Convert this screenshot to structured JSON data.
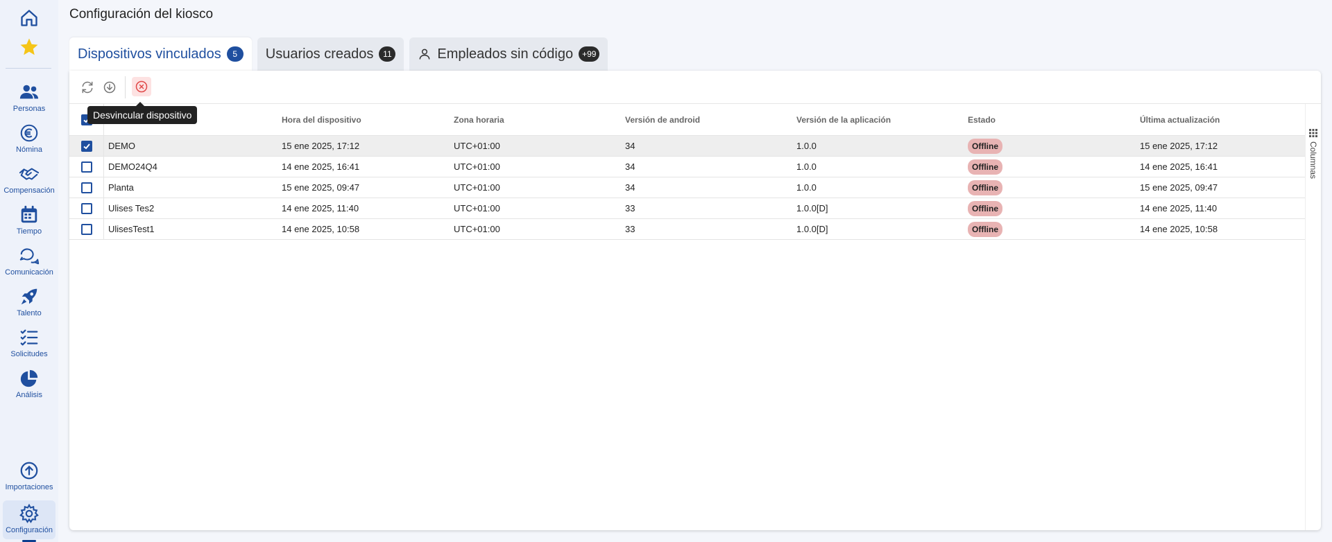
{
  "page": {
    "title": "Configuración del kiosco"
  },
  "sidebar": {
    "items": [
      {
        "label": "Personas",
        "icon": "people-icon"
      },
      {
        "label": "Nómina",
        "icon": "euro-icon"
      },
      {
        "label": "Compensación",
        "icon": "handshake-icon"
      },
      {
        "label": "Tiempo",
        "icon": "calendar-icon"
      },
      {
        "label": "Comunicación",
        "icon": "chat-icon"
      },
      {
        "label": "Talento",
        "icon": "rocket-icon"
      },
      {
        "label": "Solicitudes",
        "icon": "checklist-icon"
      },
      {
        "label": "Análisis",
        "icon": "pie-chart-icon"
      }
    ],
    "bottom": [
      {
        "label": "Importaciones",
        "icon": "upload-icon"
      },
      {
        "label": "Configuración",
        "icon": "gear-icon"
      }
    ]
  },
  "tabs": [
    {
      "label": "Dispositivos vinculados",
      "badge": "5"
    },
    {
      "label": "Usuarios creados",
      "badge": "11"
    },
    {
      "label": "Empleados sin código",
      "badge": "+99"
    }
  ],
  "toolbar": {
    "tooltip": "Desvincular dispositivo"
  },
  "table": {
    "columns": [
      "Hora del dispositivo",
      "Zona horaria",
      "Versión de android",
      "Versión de la aplicación",
      "Estado",
      "Última actualización"
    ],
    "rows": [
      {
        "name": "DEMO",
        "hora": "15 ene 2025, 17:12",
        "zona": "UTC+01:00",
        "android": "34",
        "app": "1.0.0",
        "estado": "Offline",
        "actualizacion": "15 ene 2025, 17:12",
        "checked": true
      },
      {
        "name": "DEMO24Q4",
        "hora": "14 ene 2025, 16:41",
        "zona": "UTC+01:00",
        "android": "34",
        "app": "1.0.0",
        "estado": "Offline",
        "actualizacion": "14 ene 2025, 16:41",
        "checked": false
      },
      {
        "name": "Planta",
        "hora": "15 ene 2025, 09:47",
        "zona": "UTC+01:00",
        "android": "34",
        "app": "1.0.0",
        "estado": "Offline",
        "actualizacion": "15 ene 2025, 09:47",
        "checked": false
      },
      {
        "name": "Ulises Tes2",
        "hora": "14 ene 2025, 11:40",
        "zona": "UTC+01:00",
        "android": "33",
        "app": "1.0.0[D]",
        "estado": "Offline",
        "actualizacion": "14 ene 2025, 11:40",
        "checked": false
      },
      {
        "name": "UlisesTest1",
        "hora": "14 ene 2025, 10:58",
        "zona": "UTC+01:00",
        "android": "33",
        "app": "1.0.0[D]",
        "estado": "Offline",
        "actualizacion": "14 ene 2025, 10:58",
        "checked": false
      }
    ]
  },
  "columns_toggle": {
    "label": "Columnas"
  },
  "colors": {
    "primary": "#1f4f9f",
    "star": "#f5c518",
    "status_offline": "#e8b3b3",
    "danger": "#e04848"
  }
}
